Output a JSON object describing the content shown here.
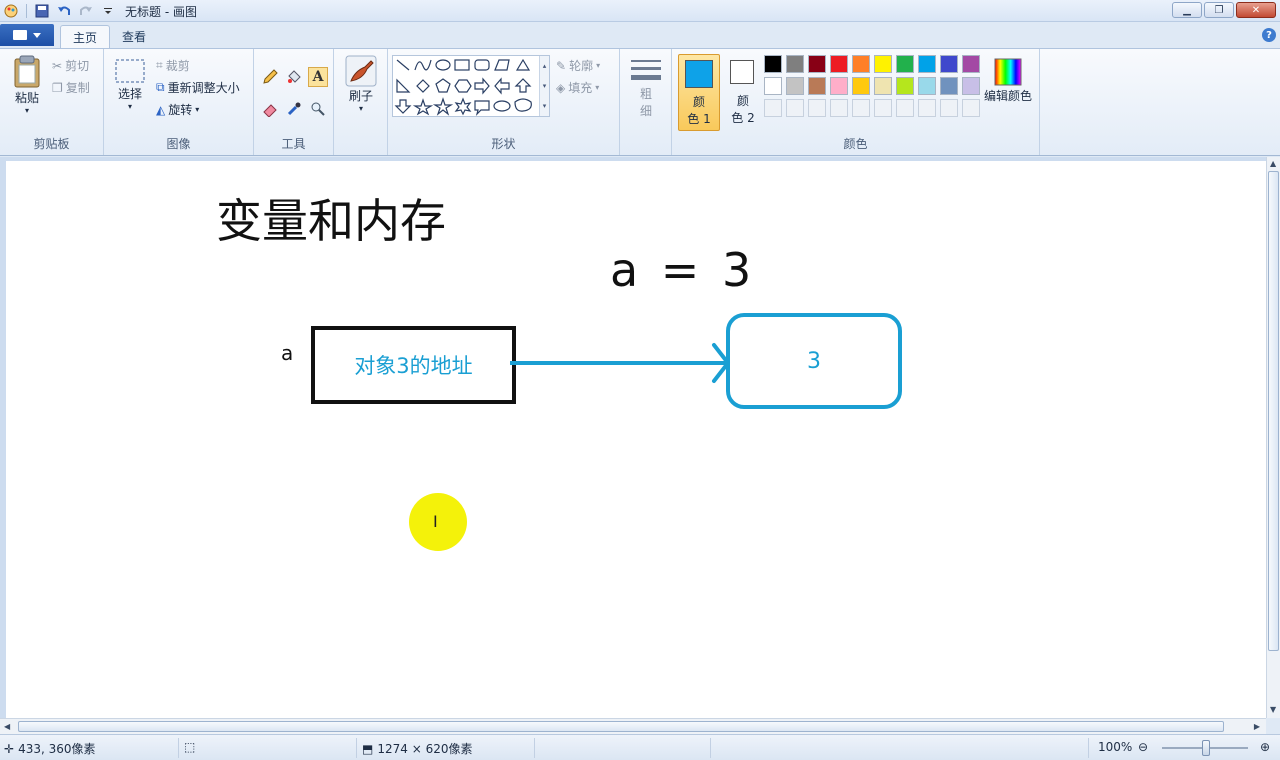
{
  "window": {
    "title": "无标题 - 画图"
  },
  "tabs": [
    {
      "label": "主页"
    },
    {
      "label": "查看"
    }
  ],
  "ribbon": {
    "clipboard": {
      "group_label": "剪贴板",
      "paste": "粘贴",
      "cut": "剪切",
      "copy": "复制"
    },
    "image": {
      "group_label": "图像",
      "select": "选择",
      "crop": "裁剪",
      "resize": "重新调整大小",
      "rotate": "旋转"
    },
    "tools": {
      "group_label": "工具",
      "brush": "刷子"
    },
    "shapes": {
      "group_label": "形状",
      "outline": "轮廓",
      "fill": "填充"
    },
    "size": {
      "label_line1": "粗",
      "label_line2": "细"
    },
    "colors": {
      "group_label": "颜色",
      "color1_line1": "颜",
      "color1_line2": "色 1",
      "color2_line1": "颜",
      "color2_line2": "色 2",
      "edit_colors": "编辑颜色",
      "color1": "#0ea2e8",
      "color2": "#ffffff",
      "palette_row1": [
        "#000000",
        "#7f7f7f",
        "#880015",
        "#ed1c24",
        "#ff7f27",
        "#fff200",
        "#22b14c",
        "#00a2e8",
        "#3f48cc",
        "#a349a4"
      ],
      "palette_row2": [
        "#ffffff",
        "#c3c3c3",
        "#b97a57",
        "#ffaec9",
        "#ffc90e",
        "#efe4b0",
        "#b5e61d",
        "#99d9ea",
        "#7092be",
        "#c8bfe7"
      ]
    }
  },
  "canvas": {
    "heading": "变量和内存",
    "equation": "a = 3",
    "var_label": "a",
    "box_text": "对象3的地址",
    "object_value": "3",
    "accent": "#1a9fd3"
  },
  "status": {
    "cursor_pos": "433, 360像素",
    "image_size": "1274 × 620像素",
    "zoom": "100%"
  }
}
